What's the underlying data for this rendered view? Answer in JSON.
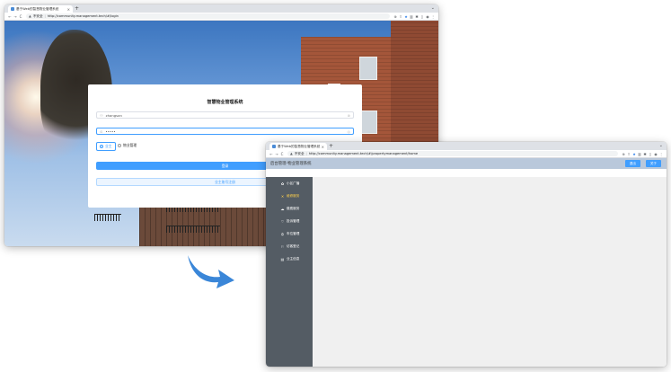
{
  "login_window": {
    "tab_title": "基于Web的智慧物业管理系统",
    "tab_close": "×",
    "new_tab": "+",
    "tab_menu": "⌄",
    "nav": {
      "back": "←",
      "forward": "→",
      "reload": "C"
    },
    "security_label": "不安全",
    "url": "http://community.management.tech/#/login",
    "toolbar_icons": [
      "⊕",
      "⇪",
      "★",
      "▥",
      "✱",
      "▯",
      "◉",
      "⋮"
    ],
    "card_title": "智慧物业管理系统",
    "username_icon": "⚇",
    "username_value": "zhangsan",
    "username_end_icon": "⊗",
    "password_icon": "⊙",
    "password_value": "•••••",
    "password_end_icon": "◎",
    "role_options": [
      {
        "label": "业主",
        "selected": true
      },
      {
        "label": "物业管理",
        "selected": false
      }
    ],
    "login_button": "登录",
    "register_button": "业主账号注册"
  },
  "transition_arrow": {
    "color": "#3a86d8"
  },
  "admin_window": {
    "tab_title": "基于Web的智慧物业管理系统",
    "tab_close": "×",
    "new_tab": "+",
    "tab_menu": "⌄",
    "nav": {
      "back": "←",
      "forward": "→",
      "reload": "C"
    },
    "security_label": "不安全",
    "url": "http://community.management.tech/#/propertymanagement/home",
    "toolbar_icons": [
      "⊕",
      "⇪",
      "★",
      "▥",
      "✱",
      "▯",
      "◉",
      "⋮"
    ],
    "header_title": "后台管理-物业管理系统",
    "header_buttons": [
      "退出",
      "关于"
    ],
    "menu_items": [
      {
        "icon": "✿",
        "label": "小区广播",
        "active": false
      },
      {
        "icon": "✕",
        "label": "维修服务",
        "active": true
      },
      {
        "icon": "☁",
        "label": "缴费服务",
        "active": false
      },
      {
        "icon": "♡",
        "label": "投诉管理",
        "active": false
      },
      {
        "icon": "⛭",
        "label": "车位管理",
        "active": false
      },
      {
        "icon": "⚐",
        "label": "访客登记",
        "active": false
      },
      {
        "icon": "▤",
        "label": "业主信息",
        "active": false
      }
    ]
  },
  "colors": {
    "primary": "#409eff",
    "sidebar": "#545c64",
    "active_menu": "#ffd04b",
    "app_header": "#b9c8db"
  }
}
